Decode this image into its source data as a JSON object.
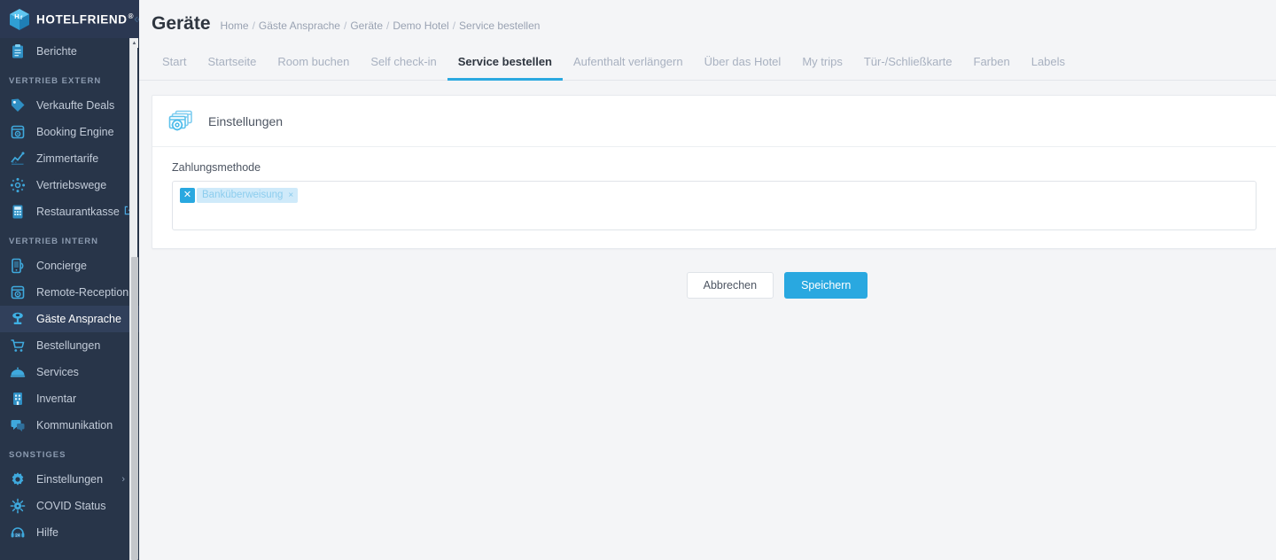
{
  "brand": {
    "name": "HOTELFRIEND",
    "registered": "®",
    "collapse_icon": "chevrons-left-icon",
    "logo_icon": "cube-hf-logo-icon"
  },
  "sidebar": {
    "groups": [
      {
        "heading": null,
        "items": [
          {
            "label": "Berichte",
            "icon": "clipboard-report-icon",
            "active": false
          }
        ]
      },
      {
        "heading": "VERTRIEB EXTERN",
        "items": [
          {
            "label": "Verkaufte Deals",
            "icon": "tag-deal-icon",
            "active": false
          },
          {
            "label": "Booking Engine",
            "icon": "booking-engine-icon",
            "active": false
          },
          {
            "label": "Zimmertarife",
            "icon": "chart-rates-icon",
            "active": false
          },
          {
            "label": "Vertriebswege",
            "icon": "network-channels-icon",
            "active": false
          },
          {
            "label": "Restaurantkasse",
            "icon": "pos-terminal-icon",
            "active": false,
            "external": "external-link-icon"
          }
        ]
      },
      {
        "heading": "VERTRIEB INTERN",
        "items": [
          {
            "label": "Concierge",
            "icon": "mobile-concierge-icon",
            "active": false
          },
          {
            "label": "Remote-Reception",
            "icon": "remote-reception-icon",
            "active": false
          },
          {
            "label": "Gäste Ansprache",
            "icon": "guest-address-icon",
            "active": true
          },
          {
            "label": "Bestellungen",
            "icon": "shopping-cart-icon",
            "active": false
          },
          {
            "label": "Services",
            "icon": "room-service-dome-icon",
            "active": false
          },
          {
            "label": "Inventar",
            "icon": "inventory-building-icon",
            "active": false
          },
          {
            "label": "Kommunikation",
            "icon": "chat-bubbles-icon",
            "active": false
          }
        ]
      },
      {
        "heading": "SONSTIGES",
        "items": [
          {
            "label": "Einstellungen",
            "icon": "gear-icon",
            "active": false,
            "chevron": "chevron-right-icon"
          },
          {
            "label": "COVID Status",
            "icon": "virus-icon",
            "active": false
          },
          {
            "label": "Hilfe",
            "icon": "headset-24h-icon",
            "active": false
          }
        ]
      }
    ],
    "scrollbar": {
      "up_arrow": "scroll-up-arrow-icon"
    }
  },
  "header": {
    "title": "Geräte",
    "breadcrumbs": [
      "Home",
      "Gäste Ansprache",
      "Geräte",
      "Demo Hotel",
      "Service bestellen"
    ],
    "breadcrumb_separator": "/"
  },
  "tabs": [
    {
      "label": "Start",
      "active": false
    },
    {
      "label": "Startseite",
      "active": false
    },
    {
      "label": "Room buchen",
      "active": false
    },
    {
      "label": "Self check-in",
      "active": false
    },
    {
      "label": "Service bestellen",
      "active": true
    },
    {
      "label": "Aufenthalt verlängern",
      "active": false
    },
    {
      "label": "Über das Hotel",
      "active": false
    },
    {
      "label": "My trips",
      "active": false
    },
    {
      "label": "Tür-/Schließkarte",
      "active": false
    },
    {
      "label": "Farben",
      "active": false
    },
    {
      "label": "Labels",
      "active": false
    }
  ],
  "card": {
    "icon": "settings-windows-gear-icon",
    "title": "Einstellungen",
    "field": {
      "label": "Zahlungsmethode",
      "placeholder": "",
      "tags": [
        {
          "label": "Banküberweisung",
          "remove_icon": "×",
          "clear_icon": "✕"
        }
      ]
    }
  },
  "actions": {
    "cancel_label": "Abbrechen",
    "save_label": "Speichern"
  },
  "colors": {
    "sidebar_bg": "#283549",
    "sidebar_active": "#31405b",
    "accent": "#29a8e0",
    "tab_active_underline": "#2ba9e0",
    "page_bg": "#f4f5f7",
    "chip_bg": "#cfeafa",
    "chip_text": "#8dcdee"
  }
}
